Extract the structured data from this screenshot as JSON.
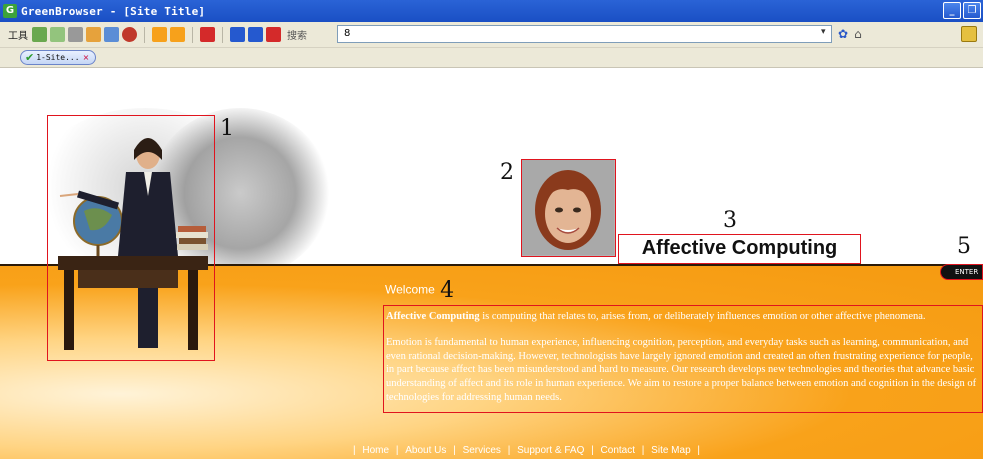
{
  "window": {
    "title": "GreenBrowser - [Site Title]",
    "app_icon": "G"
  },
  "toolbar": {
    "label": "工具",
    "search_label": "搜索",
    "search_value": "8",
    "colors": {
      "orange": "#f7a11b",
      "red": "#d42a2a",
      "blue": "#2559cf"
    }
  },
  "tabs": [
    {
      "label": "1-Site...",
      "close": "×"
    }
  ],
  "page": {
    "annotations": [
      "1",
      "2",
      "3",
      "4",
      "5"
    ],
    "headline": "Affective Computing",
    "enter_label": "ENTER",
    "welcome": "Welcome",
    "intro_bold": "Affective Computing",
    "intro_rest": " is computing that relates to, arises from, or deliberately influences emotion or other affective phenomena.",
    "body": "Emotion is fundamental to human experience, influencing cognition, perception, and everyday tasks such as learning, communication, and even rational decision-making. However, technologists have largely ignored emotion and created an often frustrating experience for people, in part because affect has been misunderstood and hard to measure. Our research develops new technologies and theories that advance basic understanding of affect and its role in human experience. We aim to restore a proper balance between emotion and cognition in the design of technologies for addressing human needs.",
    "footer_links": [
      "Home",
      "About Us",
      "Services",
      "Support & FAQ",
      "Contact",
      "Site Map"
    ],
    "footer_sep": "|",
    "accent_orange": "#f59a10",
    "highlight_red": "#e0141e"
  }
}
